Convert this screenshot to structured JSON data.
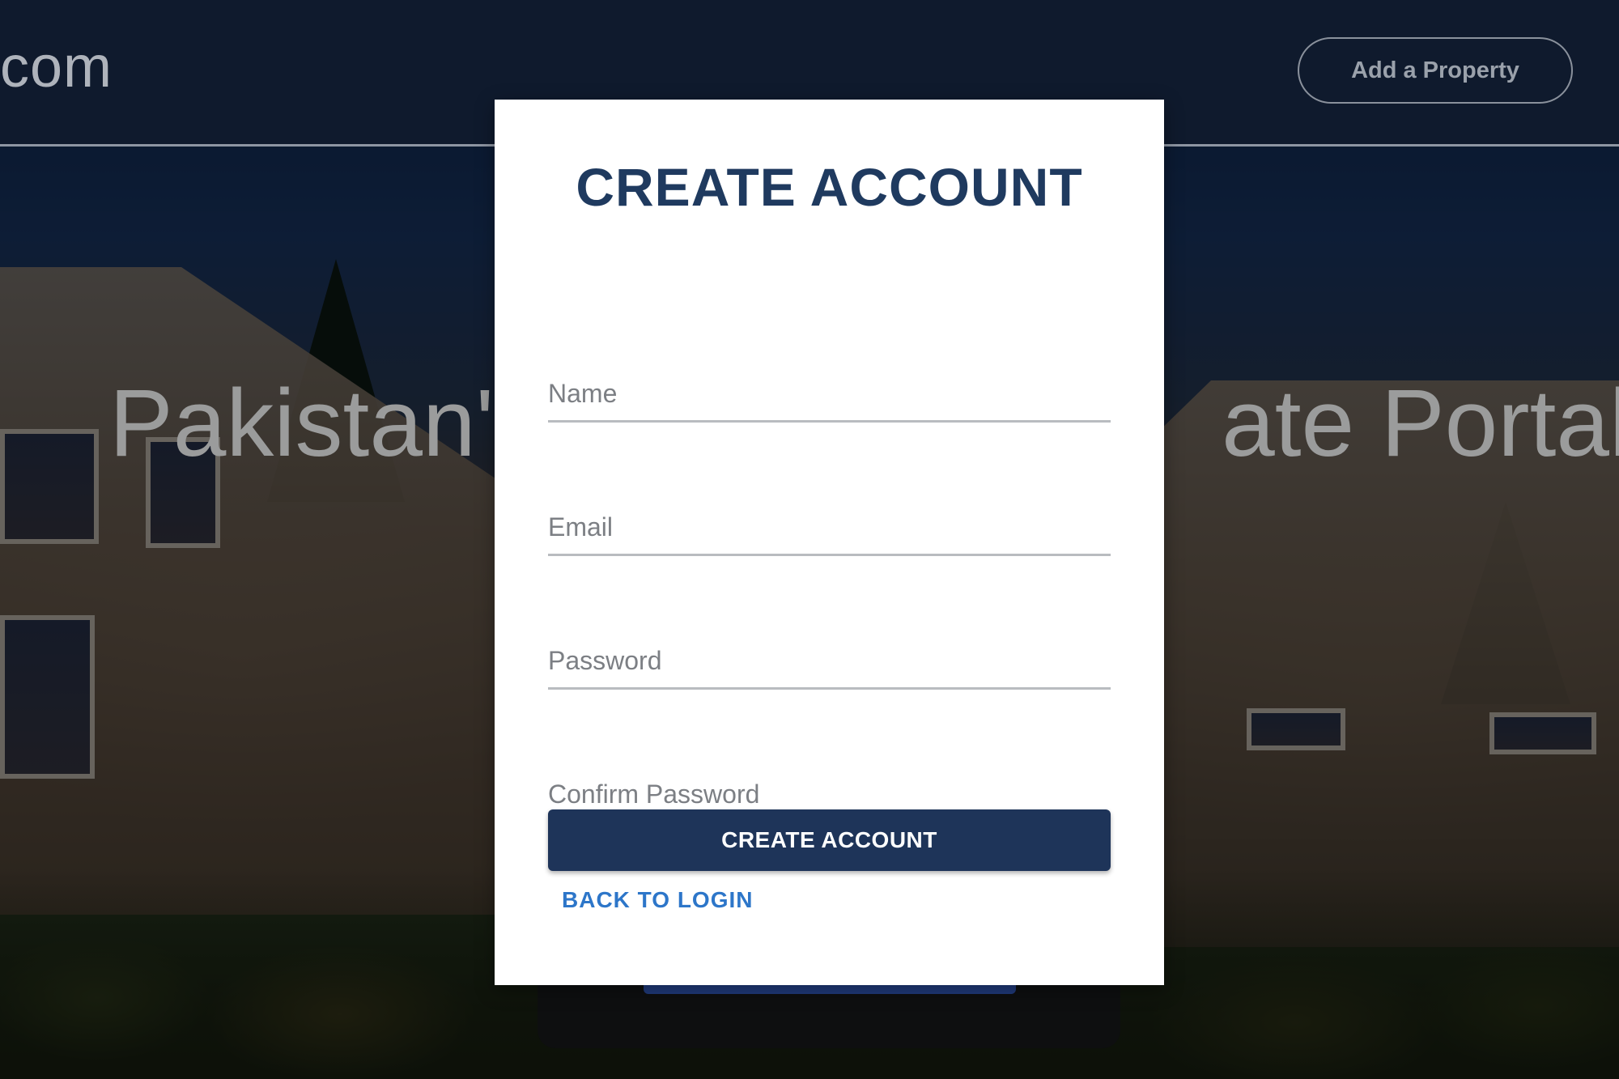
{
  "navbar": {
    "brand_text": "com",
    "add_property_label": "Add a Property"
  },
  "hero": {
    "title_left": "Pakistan's",
    "title_right": "ate Portal"
  },
  "modal": {
    "title": "CREATE ACCOUNT",
    "fields": {
      "name_placeholder": "Name",
      "email_placeholder": "Email",
      "password_placeholder": "Password",
      "confirm_password_placeholder": "Confirm Password"
    },
    "create_button_label": "CREATE ACCOUNT",
    "back_link_label": "BACK TO LOGIN"
  },
  "colors": {
    "navbar_bg": "#0f1a2d",
    "primary": "#1e3459",
    "title": "#1f3a5f",
    "link": "#2d76c9"
  }
}
